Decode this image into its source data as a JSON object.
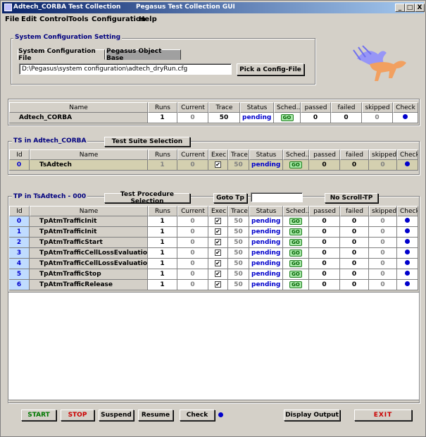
{
  "window": {
    "title": "Adtech_CORBA Test Collection",
    "subtitle": "Pegasus Test Collection GUI",
    "controls": [
      "_",
      "□",
      "X"
    ]
  },
  "menu": [
    "File",
    "Edit",
    "Control",
    "Tools",
    "Configuration",
    "Help"
  ],
  "config": {
    "legend": "System Configuration Setting",
    "tabs": [
      "System Configuration File",
      "Pegasus Object Base"
    ],
    "path": "D:\\Pegasus\\system configuration\\adtech_dryRun.cfg",
    "pick_label": "Pick a Config-File"
  },
  "collection": {
    "headers": [
      "Name",
      "Runs",
      "Current",
      "Trace",
      "Status",
      "Sched...",
      "passed",
      "failed",
      "skipped",
      "Check"
    ],
    "row": {
      "name": "Adtech_CORBA",
      "runs": "1",
      "current": "0",
      "trace": "50",
      "status": "pending",
      "sched": "GO",
      "passed": "0",
      "failed": "0",
      "skipped": "0"
    }
  },
  "ts": {
    "legend": "TS in Adtech_CORBA",
    "select_label": "Test Suite Selection",
    "headers": [
      "Id",
      "Name",
      "Runs",
      "Current",
      "Exec",
      "Trace",
      "Status",
      "Sched...",
      "passed",
      "failed",
      "skipped",
      "Check"
    ],
    "row": {
      "id": "0",
      "name": "TsAdtech",
      "runs": "1",
      "current": "0",
      "exec": "✔",
      "trace": "50",
      "status": "pending",
      "sched": "GO",
      "passed": "0",
      "failed": "0",
      "skipped": "0"
    }
  },
  "tp": {
    "legend": "TP in TsAdtech - 000",
    "select_label": "Test Procedure Selection",
    "goto_label": "Goto Tp",
    "goto_value": "",
    "noscroll_label": "No Scroll-TP",
    "headers": [
      "Id",
      "Name",
      "Runs",
      "Current",
      "Exec",
      "Trace",
      "Status",
      "Sched...",
      "passed",
      "failed",
      "skipped",
      "Check"
    ],
    "rows": [
      {
        "id": "0",
        "name": "TpAtmTrafficInit",
        "runs": "1",
        "current": "0",
        "exec": "✔",
        "trace": "50",
        "status": "pending",
        "sched": "GO",
        "passed": "0",
        "failed": "0",
        "skipped": "0"
      },
      {
        "id": "1",
        "name": "TpAtmTrafficInit",
        "runs": "1",
        "current": "0",
        "exec": "✔",
        "trace": "50",
        "status": "pending",
        "sched": "GO",
        "passed": "0",
        "failed": "0",
        "skipped": "0"
      },
      {
        "id": "2",
        "name": "TpAtmTrafficStart",
        "runs": "1",
        "current": "0",
        "exec": "✔",
        "trace": "50",
        "status": "pending",
        "sched": "GO",
        "passed": "0",
        "failed": "0",
        "skipped": "0"
      },
      {
        "id": "3",
        "name": "TpAtmTrafficCellLossEvaluation",
        "runs": "1",
        "current": "0",
        "exec": "✔",
        "trace": "50",
        "status": "pending",
        "sched": "GO",
        "passed": "0",
        "failed": "0",
        "skipped": "0"
      },
      {
        "id": "4",
        "name": "TpAtmTrafficCellLossEvaluation",
        "runs": "1",
        "current": "0",
        "exec": "✔",
        "trace": "50",
        "status": "pending",
        "sched": "GO",
        "passed": "0",
        "failed": "0",
        "skipped": "0"
      },
      {
        "id": "5",
        "name": "TpAtmTrafficStop",
        "runs": "1",
        "current": "0",
        "exec": "✔",
        "trace": "50",
        "status": "pending",
        "sched": "GO",
        "passed": "0",
        "failed": "0",
        "skipped": "0"
      },
      {
        "id": "6",
        "name": "TpAtmTrafficRelease",
        "runs": "1",
        "current": "0",
        "exec": "✔",
        "trace": "50",
        "status": "pending",
        "sched": "GO",
        "passed": "0",
        "failed": "0",
        "skipped": "0"
      }
    ]
  },
  "bottom": {
    "start": "START",
    "stop": "STOP",
    "suspend": "Suspend",
    "resume": "Resume",
    "check": "Check",
    "display": "Display Output",
    "exit": "EXIT"
  },
  "colors": {
    "title": "#0a246a",
    "status": "#0000cc",
    "start": "#007700",
    "stop": "#cc0000"
  }
}
